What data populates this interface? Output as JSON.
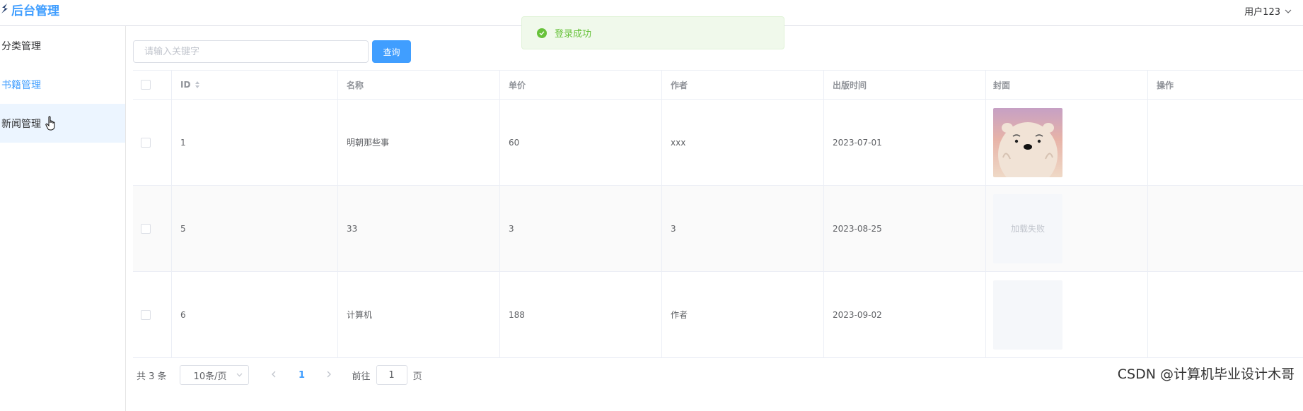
{
  "header": {
    "title": "后台管理",
    "user": "用户123"
  },
  "toast": {
    "message": "登录成功"
  },
  "sidebar": {
    "items": [
      {
        "label": "分类管理"
      },
      {
        "label": "书籍管理"
      },
      {
        "label": "新闻管理"
      }
    ]
  },
  "search": {
    "placeholder": "请输入关键字",
    "button": "查询"
  },
  "table": {
    "columns": [
      "",
      "ID",
      "名称",
      "单价",
      "作者",
      "出版时间",
      "封面",
      "操作"
    ],
    "rows": [
      {
        "id": "1",
        "name": "明朝那些事",
        "price": "60",
        "author": "xxx",
        "date": "2023-07-01",
        "cover": ""
      },
      {
        "id": "5",
        "name": "33",
        "price": "3",
        "author": "3",
        "date": "2023-08-25",
        "cover": "加载失败"
      },
      {
        "id": "6",
        "name": "计算机",
        "price": "188",
        "author": "作者",
        "date": "2023-09-02",
        "cover": ""
      }
    ]
  },
  "pagination": {
    "total": "共 3 条",
    "page_size": "10条/页",
    "current": "1",
    "goto_label": "前往",
    "goto_value": "1",
    "page_suffix": "页"
  },
  "watermark": "CSDN @计算机毕业设计木哥",
  "colors": {
    "primary": "#409eff",
    "success": "#67c23a"
  }
}
